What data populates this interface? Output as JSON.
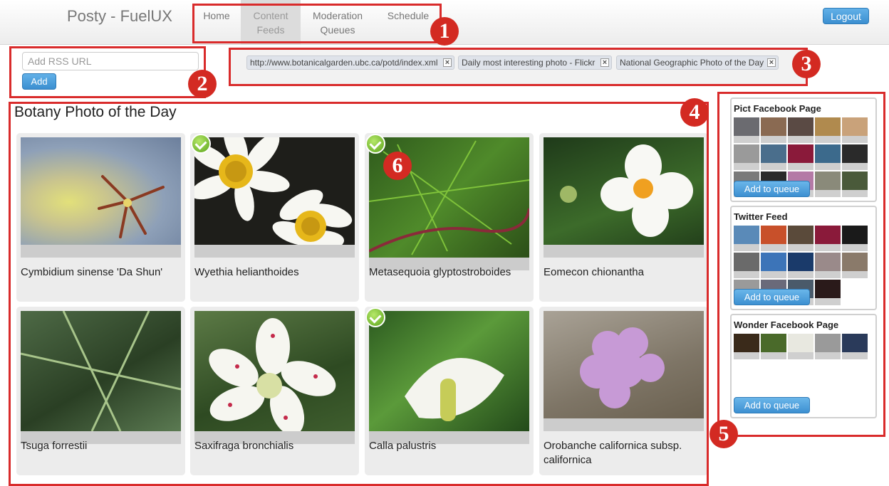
{
  "brand": "Posty - FuelUX",
  "nav": {
    "items": [
      {
        "label": "Home"
      },
      {
        "label": "Content",
        "label2": "Feeds",
        "active": true
      },
      {
        "label": "Moderation",
        "label2": "Queues"
      },
      {
        "label": "Schedule"
      }
    ],
    "logout": "Logout"
  },
  "rss": {
    "placeholder": "Add RSS URL",
    "add_label": "Add"
  },
  "feeds": [
    "http://www.botanicalgarden.ubc.ca/potd/index.xml",
    "Daily most interesting photo - Flickr",
    "National Geographic Photo of the Day"
  ],
  "section_title": "Botany Photo of the Day",
  "photos": [
    {
      "caption": "Cymbidium sinense 'Da Shun'",
      "checked": false
    },
    {
      "caption": "Wyethia helianthoides",
      "checked": true
    },
    {
      "caption": "Metasequoia glyptostroboides",
      "checked": true
    },
    {
      "caption": "Eomecon chionantha",
      "checked": false
    },
    {
      "caption": "Tsuga forrestii",
      "checked": false
    },
    {
      "caption": "Saxifraga bronchialis",
      "checked": false
    },
    {
      "caption": "Calla palustris",
      "checked": true
    },
    {
      "caption": "Orobanche californica subsp. californica",
      "checked": false
    }
  ],
  "queues": [
    {
      "title": "Pict Facebook Page",
      "button": "Add to queue"
    },
    {
      "title": "Twitter Feed",
      "button": "Add to queue"
    },
    {
      "title": "Wonder Facebook Page",
      "button": "Add to queue"
    }
  ],
  "annotations": [
    "1",
    "2",
    "3",
    "4",
    "5",
    "6"
  ],
  "colors": {
    "accent_red": "#d92b2b",
    "button_blue": "#3b8fd0",
    "check_green": "#5aa31a"
  }
}
